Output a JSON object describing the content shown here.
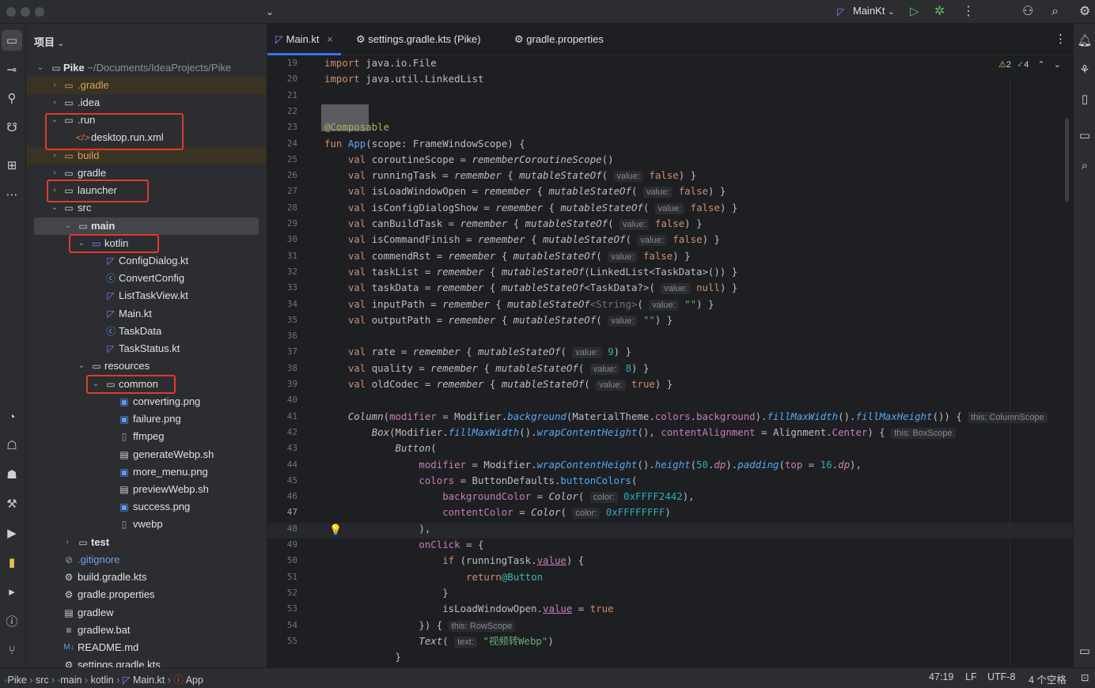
{
  "titlebar": {
    "run_config": "MainKt",
    "icons": [
      "chevron-down-icon",
      "run-icon",
      "debug-icon",
      "more-icon",
      "add-user-icon",
      "search-icon",
      "gear-icon"
    ]
  },
  "project_panel": {
    "header": "项目",
    "root": {
      "name": "Pike",
      "path": "~/Documents/IdeaProjects/Pike"
    },
    "items": [
      {
        "label": ".gradle"
      },
      {
        "label": ".idea"
      },
      {
        "label": ".run"
      },
      {
        "label": "desktop.run.xml"
      },
      {
        "label": "build"
      },
      {
        "label": "gradle"
      },
      {
        "label": "launcher"
      },
      {
        "label": "src"
      },
      {
        "label": "main"
      },
      {
        "label": "kotlin"
      },
      {
        "label": "ConfigDialog.kt"
      },
      {
        "label": "ConvertConfig"
      },
      {
        "label": "ListTaskView.kt"
      },
      {
        "label": "Main.kt"
      },
      {
        "label": "TaskData"
      },
      {
        "label": "TaskStatus.kt"
      },
      {
        "label": "resources"
      },
      {
        "label": "common"
      },
      {
        "label": "converting.png"
      },
      {
        "label": "failure.png"
      },
      {
        "label": "ffmpeg"
      },
      {
        "label": "generateWebp.sh"
      },
      {
        "label": "more_menu.png"
      },
      {
        "label": "previewWebp.sh"
      },
      {
        "label": "success.png"
      },
      {
        "label": "vwebp"
      },
      {
        "label": "test"
      },
      {
        "label": ".gitignore"
      },
      {
        "label": "build.gradle.kts"
      },
      {
        "label": "gradle.properties"
      },
      {
        "label": "gradlew"
      },
      {
        "label": "gradlew.bat"
      },
      {
        "label": "README.md"
      },
      {
        "label": "settings.gradle.kts"
      }
    ]
  },
  "tabs": [
    {
      "label": "Main.kt"
    },
    {
      "label": "settings.gradle.kts (Pike)"
    },
    {
      "label": "gradle.properties"
    }
  ],
  "inspections": {
    "warnings": "2",
    "ok": "4"
  },
  "editor": {
    "current_line": "47",
    "line_numbers": [
      "19",
      "20",
      "21",
      "22",
      "23",
      "24",
      "25",
      "26",
      "27",
      "28",
      "29",
      "30",
      "31",
      "32",
      "33",
      "34",
      "35",
      "36",
      "37",
      "38",
      "39",
      "40",
      "41",
      "42",
      "43",
      "44",
      "45",
      "46",
      "47",
      "48",
      "49",
      "50",
      "51",
      "52",
      "53",
      "54",
      "55"
    ]
  },
  "status": {
    "breadcrumbs": [
      "Pike",
      "src",
      "main",
      "kotlin",
      "Main.kt",
      "App"
    ],
    "position": "47:19",
    "line_sep": "LF",
    "encoding": "UTF-8",
    "indent": "4 个空格"
  }
}
